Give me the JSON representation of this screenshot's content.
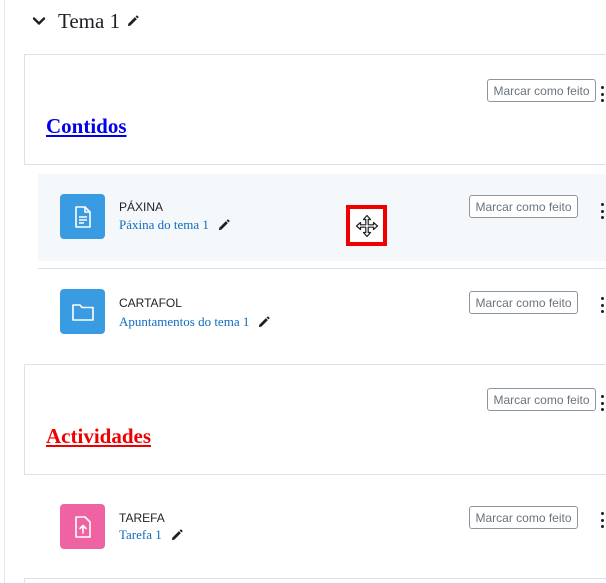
{
  "section": {
    "title": "Tema 1",
    "collapse_icon": "chevron-down-icon",
    "edit_icon": "pencil-icon"
  },
  "completion_button_label": "Marcar como feito",
  "labels": [
    {
      "text": "Contidos",
      "color": "#0000ee"
    },
    {
      "text": "Actividades",
      "color": "#ee0000"
    }
  ],
  "activities": [
    {
      "type": "PÁXINA",
      "name": "Páxina do tema 1",
      "icon": "page-icon",
      "icon_color": "#399be2"
    },
    {
      "type": "CARTAFOL",
      "name": "Apuntamentos do tema 1",
      "icon": "folder-icon",
      "icon_color": "#399be2"
    },
    {
      "type": "TAREFA",
      "name": "Tarefa 1",
      "icon": "assignment-icon",
      "icon_color": "#f063a3"
    }
  ],
  "drag_handle": {
    "icon": "move-icon",
    "highlight_color": "#ee0000"
  },
  "colors": {
    "accent": "#0f6cbf",
    "hover_bg": "#f5f8fa",
    "border": "#dee2e6"
  }
}
